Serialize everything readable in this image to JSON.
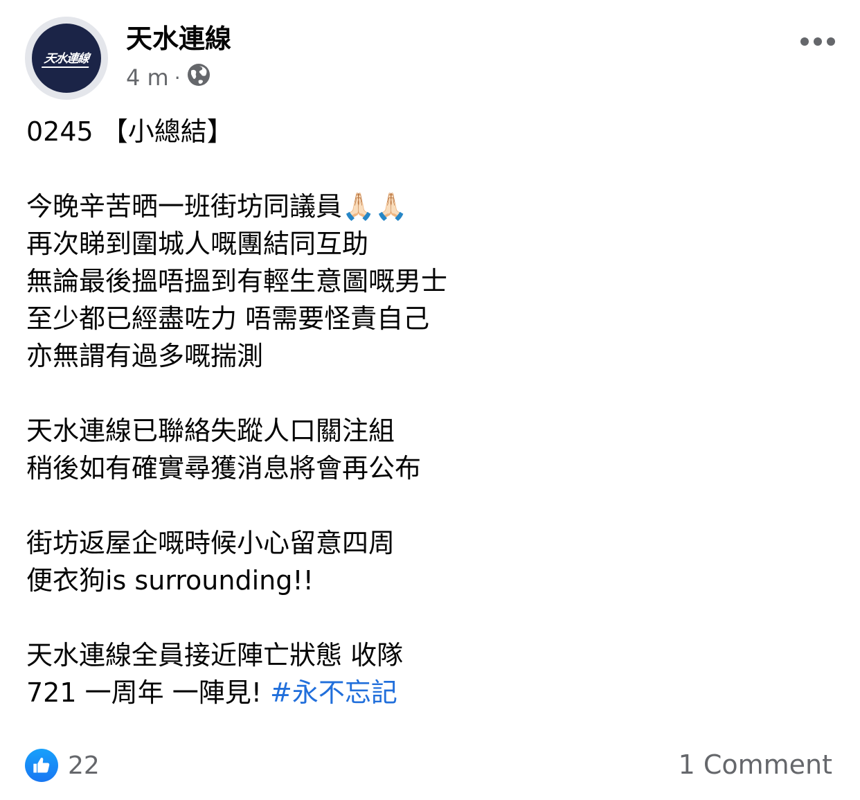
{
  "post": {
    "page_name": "天水連線",
    "avatar_text": "天水連線",
    "timestamp": "4 m",
    "separator": "·",
    "privacy_icon": "globe-icon",
    "more_icon": "more-horizontal-icon",
    "body_lines": [
      "0245 【小總結】",
      "",
      "今晚辛苦晒一班街坊同議員🙏🏻🙏🏻",
      "再次睇到圍城人嘅團結同互助",
      "無論最後搵唔搵到有輕生意圖嘅男士",
      "至少都已經盡咗力 唔需要怪責自己",
      "亦無謂有過多嘅揣測",
      "",
      "天水連線已聯絡失蹤人口關注組",
      "稍後如有確實尋獲消息將會再公布",
      "",
      "街坊返屋企嘅時候小心留意四周",
      "便衣狗is surrounding!!",
      "",
      "天水連線全員接近陣亡狀態 收隊"
    ],
    "last_line_text": "721 一周年 一陣見! ",
    "hashtag": "#永不忘記"
  },
  "footer": {
    "like_icon": "like-thumb-icon",
    "reaction_count": "22",
    "comments_label": "1 Comment"
  },
  "colors": {
    "hashtag": "#216fdb",
    "meta_text": "#65676b",
    "like_blue": "#1877f2",
    "avatar_bg": "#1b2447"
  }
}
